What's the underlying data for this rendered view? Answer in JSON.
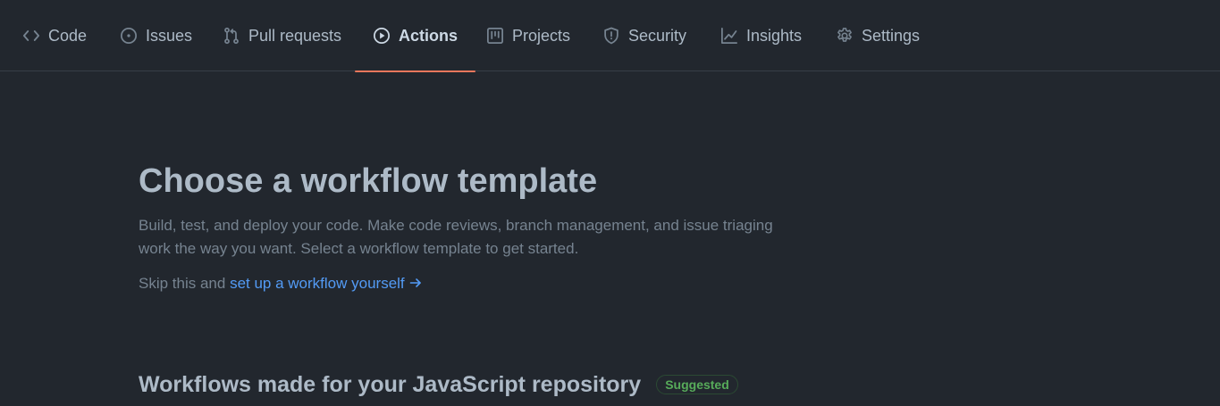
{
  "tabs": [
    {
      "label": "Code",
      "icon": "code-icon"
    },
    {
      "label": "Issues",
      "icon": "issue-opened-icon"
    },
    {
      "label": "Pull requests",
      "icon": "git-pull-request-icon"
    },
    {
      "label": "Actions",
      "icon": "play-icon",
      "selected": true
    },
    {
      "label": "Projects",
      "icon": "project-icon"
    },
    {
      "label": "Security",
      "icon": "shield-icon"
    },
    {
      "label": "Insights",
      "icon": "graph-icon"
    },
    {
      "label": "Settings",
      "icon": "gear-icon"
    }
  ],
  "main": {
    "title": "Choose a workflow template",
    "description": "Build, test, and deploy your code. Make code reviews, branch management, and issue triaging work the way you want. Select a workflow template to get started.",
    "skip_prefix": "Skip this and ",
    "skip_link": "set up a workflow yourself"
  },
  "section": {
    "title": "Workflows made for your JavaScript repository",
    "badge": "Suggested"
  },
  "colors": {
    "background": "#22272e",
    "text": "#adbac7",
    "muted": "#768390",
    "link": "#539bf5",
    "selected_underline": "#ec775c",
    "badge_green": "#57ab5a"
  }
}
